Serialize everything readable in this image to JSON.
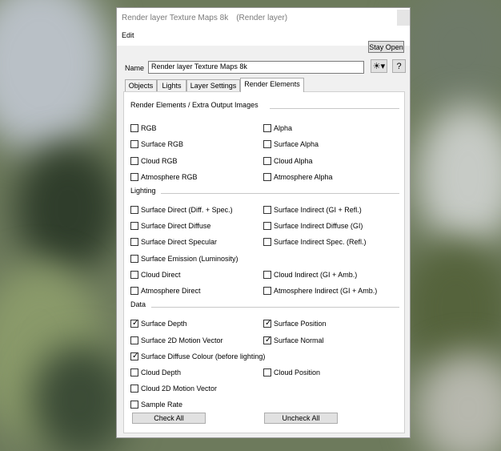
{
  "window": {
    "title": "Render layer Texture Maps 8k",
    "subtitle": "(Render layer)"
  },
  "menu": {
    "edit": "Edit"
  },
  "toolbar": {
    "stay_open": "Stay Open",
    "name_label": "Name",
    "name_value": "Render layer Texture Maps 8k",
    "help": "?"
  },
  "tabs": [
    {
      "label": "Objects",
      "active": false
    },
    {
      "label": "Lights",
      "active": false
    },
    {
      "label": "Layer Settings",
      "active": false
    },
    {
      "label": "Render Elements",
      "active": true
    }
  ],
  "sections": {
    "extra": "Render Elements / Extra Output Images",
    "lighting": "Lighting",
    "data": "Data"
  },
  "checkboxes": [
    {
      "label": "RGB",
      "checked": false
    },
    {
      "label": "Alpha",
      "checked": false
    },
    {
      "label": "Surface RGB",
      "checked": false
    },
    {
      "label": "Surface Alpha",
      "checked": false
    },
    {
      "label": "Cloud RGB",
      "checked": false
    },
    {
      "label": "Cloud Alpha",
      "checked": false
    },
    {
      "label": "Atmosphere RGB",
      "checked": false
    },
    {
      "label": "Atmosphere Alpha",
      "checked": false
    },
    {
      "label": "Surface Direct (Diff. + Spec.)",
      "checked": false
    },
    {
      "label": "Surface Indirect (GI + Refl.)",
      "checked": false
    },
    {
      "label": "Surface Direct Diffuse",
      "checked": false
    },
    {
      "label": "Surface Indirect Diffuse (GI)",
      "checked": false
    },
    {
      "label": "Surface Direct Specular",
      "checked": false
    },
    {
      "label": "Surface Indirect Spec. (Refl.)",
      "checked": false
    },
    {
      "label": "Surface Emission (Luminosity)",
      "checked": false
    },
    {
      "label": "Cloud Direct",
      "checked": false
    },
    {
      "label": "Cloud Indirect (GI + Amb.)",
      "checked": false
    },
    {
      "label": "Atmosphere Direct",
      "checked": false
    },
    {
      "label": "Atmosphere Indirect (GI + Amb.)",
      "checked": false
    },
    {
      "label": "Surface Depth",
      "checked": true
    },
    {
      "label": "Surface Position",
      "checked": true
    },
    {
      "label": "Surface 2D Motion Vector",
      "checked": false
    },
    {
      "label": "Surface Normal",
      "checked": true
    },
    {
      "label": "Surface Diffuse Colour (before lighting)",
      "checked": true
    },
    {
      "label": "Cloud Depth",
      "checked": false
    },
    {
      "label": "Cloud Position",
      "checked": false
    },
    {
      "label": "Cloud 2D Motion Vector",
      "checked": false
    },
    {
      "label": "Sample Rate",
      "checked": false
    }
  ],
  "buttons": {
    "check_all": "Check All",
    "uncheck_all": "Uncheck All"
  },
  "icons": {
    "gear": "gear-icon",
    "check": "checkmark-icon"
  }
}
